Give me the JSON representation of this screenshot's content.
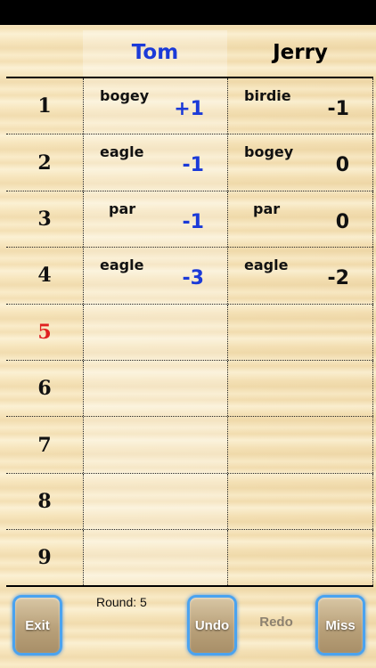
{
  "players": [
    {
      "name": "Tom",
      "color": "#1b3ad8"
    },
    {
      "name": "Jerry",
      "color": "#111111"
    }
  ],
  "holes": [
    {
      "number": "1",
      "current": false,
      "results": [
        {
          "label": "bogey",
          "score": "+1"
        },
        {
          "label": "birdie",
          "score": "-1"
        }
      ]
    },
    {
      "number": "2",
      "current": false,
      "results": [
        {
          "label": "eagle",
          "score": "-1"
        },
        {
          "label": "bogey",
          "score": "0"
        }
      ]
    },
    {
      "number": "3",
      "current": false,
      "results": [
        {
          "label": "par",
          "score": "-1"
        },
        {
          "label": "par",
          "score": "0"
        }
      ]
    },
    {
      "number": "4",
      "current": false,
      "results": [
        {
          "label": "eagle",
          "score": "-3"
        },
        {
          "label": "eagle",
          "score": "-2"
        }
      ]
    },
    {
      "number": "5",
      "current": true,
      "results": [
        {
          "label": "",
          "score": ""
        },
        {
          "label": "",
          "score": ""
        }
      ]
    },
    {
      "number": "6",
      "current": false,
      "results": [
        {
          "label": "",
          "score": ""
        },
        {
          "label": "",
          "score": ""
        }
      ]
    },
    {
      "number": "7",
      "current": false,
      "results": [
        {
          "label": "",
          "score": ""
        },
        {
          "label": "",
          "score": ""
        }
      ]
    },
    {
      "number": "8",
      "current": false,
      "results": [
        {
          "label": "",
          "score": ""
        },
        {
          "label": "",
          "score": ""
        }
      ]
    },
    {
      "number": "9",
      "current": false,
      "results": [
        {
          "label": "",
          "score": ""
        },
        {
          "label": "",
          "score": ""
        }
      ]
    }
  ],
  "footer": {
    "round_label": "Round: 5",
    "exit_label": "Exit",
    "undo_label": "Undo",
    "redo_label": "Redo",
    "miss_label": "Miss"
  },
  "colors": {
    "accent_blue": "#1b3ad8",
    "current_hole": "#e02020",
    "button_glow": "#4aa3f0"
  }
}
